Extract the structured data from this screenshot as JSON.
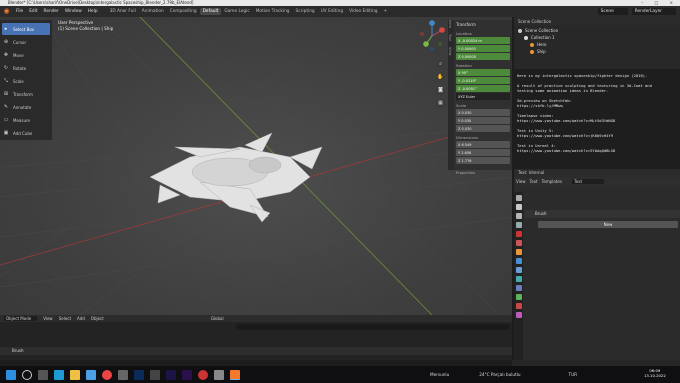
{
  "window": {
    "title": "Blender* [C:\\Users\\sharif\\OneDrive\\Desktop\\intergalactic Spaceship_Blender_2.79b_ElAtend]",
    "controls": "–  □  ×"
  },
  "menubar": {
    "menus": [
      "File",
      "Edit",
      "Render",
      "Window",
      "Help"
    ],
    "workspaces": [
      "3D Anor Full",
      "Animation",
      "Compositing",
      "Default",
      "Game Logic",
      "Motion Tracking",
      "Scripting",
      "UV Editing",
      "Video Editing",
      "+"
    ],
    "active_workspace": "Default",
    "scene_label": "Scene",
    "layer_label": "RenderLayer"
  },
  "toolbar": {
    "tools": [
      {
        "label": "Select Box",
        "icon": "cursor-icon"
      },
      {
        "label": "Cursor",
        "icon": "crosshair-icon"
      },
      {
        "label": "Move",
        "icon": "move-icon"
      },
      {
        "label": "Rotate",
        "icon": "rotate-icon"
      },
      {
        "label": "Scale",
        "icon": "scale-icon"
      },
      {
        "label": "Transform",
        "icon": "transform-icon"
      },
      {
        "label": "Annotate",
        "icon": "pencil-icon"
      },
      {
        "label": "Measure",
        "icon": "ruler-icon"
      },
      {
        "label": "Add Cube",
        "icon": "cube-icon"
      }
    ]
  },
  "viewport": {
    "perspective": "User Perspective",
    "collection": "(1) Scene Collection | Ship"
  },
  "npanel": {
    "header": "Transform",
    "location_label": "Location",
    "location": [
      "X  -0.00024 m",
      "Y  0.00000",
      "Z  0.00000"
    ],
    "rotation_label": "Rotation",
    "rotation": [
      "X  90°",
      "Y  -0.0219°",
      "Z  -0.0051°"
    ],
    "rotation_mode": "XYZ Euler",
    "scale_label": "Scale",
    "scale": [
      "X  0.030",
      "Y  0.030",
      "Z  0.030"
    ],
    "dimensions_label": "Dimensions",
    "dimensions": [
      "X  6.549",
      "Y  2.658",
      "Z  1.776"
    ],
    "properties_label": "Properties",
    "tabs": [
      "Item",
      "Tool",
      "View"
    ]
  },
  "timeline": {
    "mode": "Object Mode",
    "menus": [
      "View",
      "Select",
      "Add",
      "Object"
    ],
    "global": "Global",
    "brush_row": "Brush"
  },
  "outliner": {
    "header": "Scene Collection",
    "rows": [
      "Scene Collection",
      "Collection 1",
      "Hero",
      "Ship"
    ]
  },
  "text_editor": {
    "lines": [
      "Here is my intergalactic spaceship/fighter design (2016).",
      "",
      "A result of practice sculpting and texturing in 3d-Coat and",
      "testing some animation ideas in Blender.",
      "",
      "3d-preview on Sketchfab:",
      "https://skfb.ly/MMwq",
      "",
      "Timelapse video:",
      "https://www.youtube.com/watch?v=MLt5d3YdNG8",
      "",
      "Test in Unity 5:",
      "https://www.youtube.com/watch?v=jK6b9cH4Y9",
      "",
      "Test in Unreal 4:",
      "https://www.youtube.com/watch?v=SYbAqQdBLS8"
    ],
    "footer": "Text: Internal",
    "header_items": [
      "View",
      "Text",
      "Templates"
    ],
    "file_name": "Text"
  },
  "properties": {
    "brush_label": "Brush",
    "new_button": "New"
  },
  "taskbar": {
    "weather": "24°C Parçalı bulutlu",
    "location": "Mersunlu",
    "lang": "TUR",
    "time": "06:09",
    "date": "13.10.2022"
  }
}
